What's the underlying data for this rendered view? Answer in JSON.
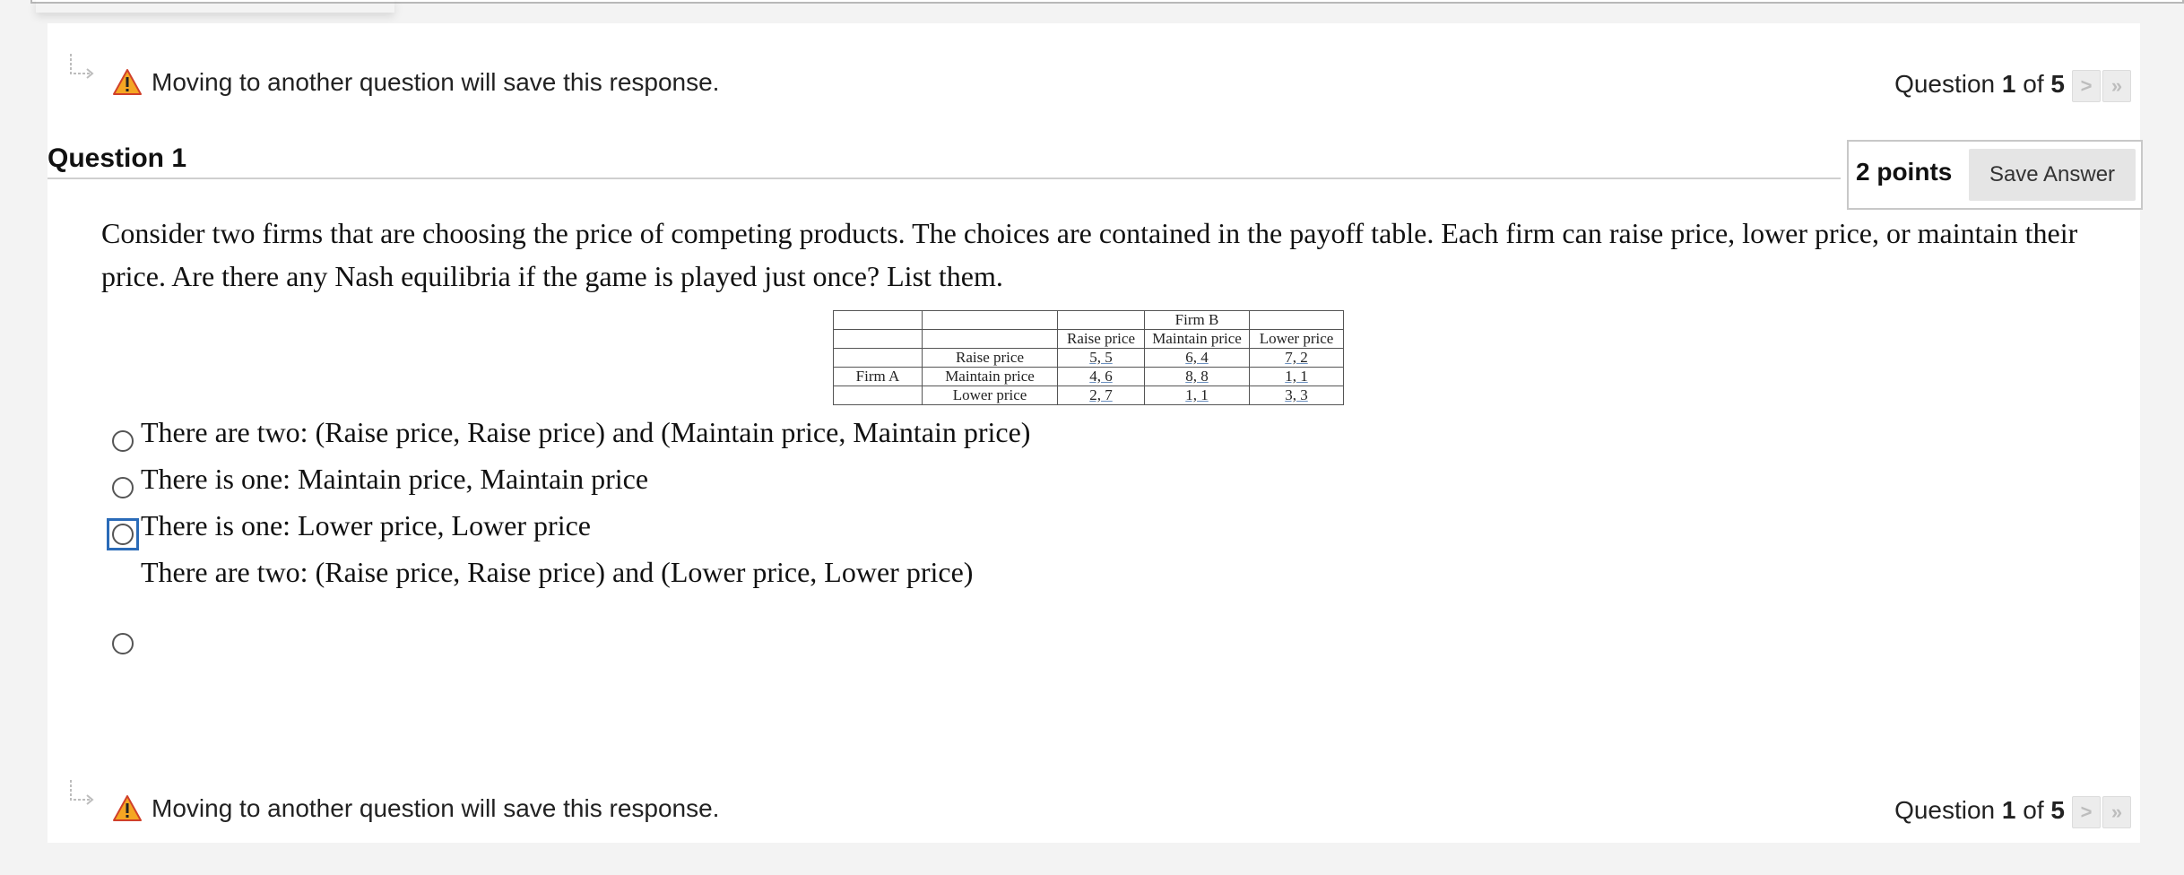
{
  "notice": {
    "text": "Moving to another question will save this response."
  },
  "navigation": {
    "prefix": "Question",
    "current": "1",
    "middle": "of",
    "total": "5",
    "next_glyph": ">",
    "last_glyph": "»"
  },
  "question": {
    "title": "Question 1",
    "points": "2 points",
    "save_label": "Save Answer",
    "text": "Consider two firms that are choosing the price of competing products. The choices are contained in the payoff table. Each firm can raise price, lower price, or maintain their price. Are there any Nash equilibria if the game is played just once? List them."
  },
  "payoff_table": {
    "firm_b": "Firm B",
    "firm_a": "Firm A",
    "columns": [
      "Raise price",
      "Maintain price",
      "Lower price"
    ],
    "rows": [
      {
        "label": "Raise price",
        "cells": [
          "5, 5",
          "6, 4",
          "7, 2"
        ]
      },
      {
        "label": "Maintain price",
        "cells": [
          "4, 6",
          "8, 8",
          "1, 1"
        ]
      },
      {
        "label": "Lower price",
        "cells": [
          "2, 7",
          "1, 1",
          "3, 3"
        ]
      }
    ]
  },
  "options": [
    "There are two: (Raise price, Raise price) and (Maintain price, Maintain price)",
    "There is one: Maintain price, Maintain price",
    "There is one: Lower price, Lower price",
    "There are two: (Raise price, Raise price) and (Lower price, Lower price)"
  ],
  "colors": {
    "warning": "#f5a623",
    "focus": "#2a6bb8",
    "background": "#f3f3f3"
  },
  "icons": {
    "warning": "warning-icon",
    "hook": "hook-arrow-icon"
  }
}
